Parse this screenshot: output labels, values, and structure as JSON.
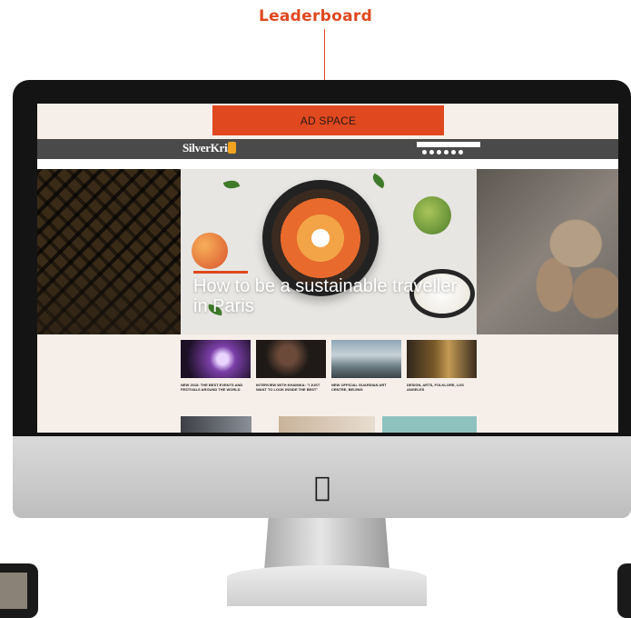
{
  "callout": {
    "label": "Leaderboard"
  },
  "screen": {
    "ad_space": "AD SPACE",
    "site": {
      "logo": "SilverKris",
      "tagline": "",
      "search_placeholder": "",
      "nav": [
        "",
        "",
        "",
        ""
      ]
    },
    "hero": {
      "headline": "How to be a sustainable traveller in Paris"
    },
    "thumbnails": [
      {
        "title": "NEW 2018: THE BEST EVENTS AND FESTIVALS AROUND THE WORLD"
      },
      {
        "title": "INTERVIEW WITH KHAMIKA: \"I JUST WANT TO LOOK INSIDE THE BEST\""
      },
      {
        "title": "NEW OFFICIAL GUARDIAN ART CENTRE, BEIJING"
      },
      {
        "title": "DESIGN, ARTS, FOLKLORE, LOS ANGELES"
      }
    ]
  },
  "colors": {
    "accent": "#e0481f",
    "header_bg": "#4a4a4a",
    "screen_bg": "#f6efe9"
  }
}
